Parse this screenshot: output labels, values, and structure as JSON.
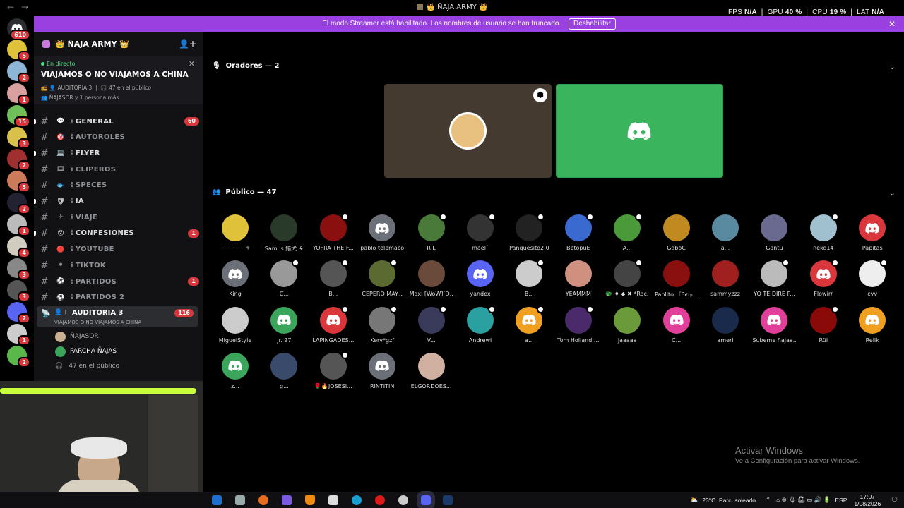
{
  "window": {
    "title": "👑 ÑAJA ARMY 👑",
    "back": "←",
    "forward": "→"
  },
  "overlay": {
    "fps_label": "FPS",
    "fps": "N/A",
    "gpu_label": "GPU",
    "gpu": "40 %",
    "cpu_label": "CPU",
    "cpu": "19 %",
    "lat_label": "LAT",
    "lat": "N/A"
  },
  "banner": {
    "text": "El modo Streamer está habilitado. Los nombres de usuario se han truncado.",
    "button": "Deshabilitar",
    "close": "✕"
  },
  "guilds": {
    "home_badge": "610",
    "items": [
      {
        "badge": "5",
        "color": "#e0c23a"
      },
      {
        "badge": "2",
        "color": "#8fb5d6"
      },
      {
        "badge": "1",
        "color": "#d9a0a0"
      },
      {
        "badge": "15",
        "color": "#6fbf5a"
      },
      {
        "badge": "3",
        "color": "#d8c04a"
      },
      {
        "badge": "2",
        "color": "#a03030"
      },
      {
        "badge": "5",
        "color": "#cc7b5a"
      },
      {
        "badge": "2",
        "color": "#222233"
      },
      {
        "badge": "1",
        "color": "#bbbbbb"
      },
      {
        "badge": "4",
        "color": "#d0ccc0"
      },
      {
        "badge": "3",
        "color": "#888888"
      },
      {
        "badge": "3",
        "color": "#555555"
      },
      {
        "badge": "2",
        "color": "#5865f2"
      },
      {
        "badge": "1",
        "color": "#cccccc"
      },
      {
        "badge": "2",
        "color": "#5ab84a"
      }
    ]
  },
  "server": {
    "name": "👑 ÑAJA ARMY 👑",
    "chevron": "⌄"
  },
  "live": {
    "tag": "En directo",
    "title": "VIAJAMOS O NO VIAJAMOS A CHINA",
    "channel": "AUDITORIA 3",
    "audience": "47 en el público",
    "speakers": "ÑAJASOR y 1 persona más"
  },
  "channels": [
    {
      "emoji": "💬",
      "label": "GENERAL",
      "count": "60",
      "muted": false,
      "dot": true
    },
    {
      "emoji": "🎯",
      "label": "AUTOROLES",
      "count": "",
      "muted": true,
      "dot": false
    },
    {
      "emoji": "💻",
      "label": "FLYER",
      "count": "",
      "muted": false,
      "dot": true
    },
    {
      "emoji": "🎞",
      "label": "CLIPEROS",
      "count": "",
      "muted": true,
      "dot": false
    },
    {
      "emoji": "🐟",
      "label": "SPECES",
      "count": "",
      "muted": true,
      "dot": false
    },
    {
      "emoji": "🛡",
      "label": "IA",
      "count": "",
      "muted": false,
      "dot": true
    },
    {
      "emoji": "✈",
      "label": "VIAJE",
      "count": "",
      "muted": true,
      "dot": false
    },
    {
      "emoji": "😮",
      "label": "CONFESIONES",
      "count": "1",
      "muted": false,
      "dot": true
    },
    {
      "emoji": "🔴",
      "label": "YOUTUBE",
      "count": "",
      "muted": true,
      "dot": false
    },
    {
      "emoji": "⚫",
      "label": "TIKTOK",
      "count": "",
      "muted": true,
      "dot": false
    },
    {
      "emoji": "⚽",
      "label": "PARTIDOS",
      "count": "1",
      "muted": true,
      "dot": false
    },
    {
      "emoji": "⚽",
      "label": "PARTIDOS 2",
      "count": "",
      "muted": true,
      "dot": false
    }
  ],
  "active_channel": {
    "label": "AUDITORIA 3",
    "topic": "VIAJAMOS O NO VIAJAMOS A CHINA",
    "count": "116"
  },
  "stage_members": [
    {
      "name": "ÑAJASOR"
    },
    {
      "name": "PARCHA ÑAJAS"
    }
  ],
  "stage_audience": "47 en el público",
  "main": {
    "speakers_header": "Oradores — 2",
    "audience_header": "Público — 47"
  },
  "audience": [
    {
      "name": "~~~~~ ⚘",
      "color": "#e0c23a",
      "mod": false
    },
    {
      "name": "Samus.錯犬 ⚘",
      "color": "#2a3a2a",
      "mod": false
    },
    {
      "name": "YOFRA THE F...",
      "color": "#8a1010",
      "mod": true
    },
    {
      "name": "pablo telemaco",
      "color": "#6b6f78",
      "mod": false
    },
    {
      "name": "R L",
      "color": "#4a7a3a",
      "mod": true
    },
    {
      "name": "mael¨",
      "color": "#333",
      "mod": true
    },
    {
      "name": "Panquesito2.0",
      "color": "#222",
      "mod": true
    },
    {
      "name": "BetopuE",
      "color": "#3a6ad0",
      "mod": true
    },
    {
      "name": "A...",
      "color": "#4a9a3a",
      "mod": true
    },
    {
      "name": "GaboC",
      "color": "#c08a20",
      "mod": false
    },
    {
      "name": "a...",
      "color": "#5a8aa0",
      "mod": false
    },
    {
      "name": "Gantu",
      "color": "#6a6a90",
      "mod": false
    },
    {
      "name": "neko14",
      "color": "#a0c0d0",
      "mod": true
    },
    {
      "name": "Papitas",
      "color": "#da373c",
      "mod": false
    },
    {
      "name": "King",
      "color": "#6b6f78",
      "mod": false
    },
    {
      "name": "C...",
      "color": "#999",
      "mod": true
    },
    {
      "name": "B...",
      "color": "#555",
      "mod": true
    },
    {
      "name": "CEPERO MAY...",
      "color": "#5a6a30",
      "mod": true
    },
    {
      "name": "Maxi [WoW][D...",
      "color": "#6a4a3a",
      "mod": false
    },
    {
      "name": "yandex",
      "color": "#5865f2",
      "mod": false
    },
    {
      "name": "B...",
      "color": "#ccc",
      "mod": true
    },
    {
      "name": "YEAMMM",
      "color": "#d09080",
      "mod": false
    },
    {
      "name": "🐲 ♦ ◆ ✖ *Roc...",
      "color": "#444",
      "mod": true
    },
    {
      "name": "Pablito 『Зє𝔯𝔭...",
      "color": "#8a1010",
      "mod": false
    },
    {
      "name": "sammyzzz",
      "color": "#a02020",
      "mod": false
    },
    {
      "name": "YO TE DIRE P...",
      "color": "#bbb",
      "mod": true
    },
    {
      "name": "Flowirr",
      "color": "#da373c",
      "mod": true
    },
    {
      "name": "cvv",
      "color": "#eee",
      "mod": true
    },
    {
      "name": "MiguelStyle",
      "color": "#ccc",
      "mod": false
    },
    {
      "name": "Jr. 27",
      "color": "#3ba55c",
      "mod": false
    },
    {
      "name": "LAPINGADES...",
      "color": "#da373c",
      "mod": true
    },
    {
      "name": "Kerv*gzf",
      "color": "#777",
      "mod": true
    },
    {
      "name": "V...",
      "color": "#3a3a5a",
      "mod": true
    },
    {
      "name": "Andrewi",
      "color": "#2aa0a0",
      "mod": true
    },
    {
      "name": "a...",
      "color": "#f0a020",
      "mod": true
    },
    {
      "name": "Tom Holland ...",
      "color": "#4a2a6a",
      "mod": true
    },
    {
      "name": "jaaaaa",
      "color": "#6a9a3a",
      "mod": false
    },
    {
      "name": "C...",
      "color": "#e0409a",
      "mod": false
    },
    {
      "name": "ameri",
      "color": "#1a2a4a",
      "mod": false
    },
    {
      "name": "Subeme ñajaa...",
      "color": "#e0409a",
      "mod": false
    },
    {
      "name": "Rüi",
      "color": "#8a0a0a",
      "mod": true
    },
    {
      "name": "Relik",
      "color": "#f0a020",
      "mod": false
    },
    {
      "name": "z...",
      "color": "#3ba55c",
      "mod": false
    },
    {
      "name": "g...",
      "color": "#3a4a6a",
      "mod": false
    },
    {
      "name": "🌹🔥JOSESI...",
      "color": "#555",
      "mod": true
    },
    {
      "name": "RINTITIN",
      "color": "#6b6f78",
      "mod": false
    },
    {
      "name": "ELGORDOES...",
      "color": "#d0b0a0",
      "mod": false
    }
  ],
  "watermark": {
    "title": "Activar Windows",
    "subtitle": "Ve a Configuración para activar Windows."
  },
  "tray": {
    "weather": "23°C",
    "condition": "Parc. soleado",
    "lang": "ESP",
    "time": "17:07",
    "date": "1/08/2026",
    "up": "⌃"
  }
}
